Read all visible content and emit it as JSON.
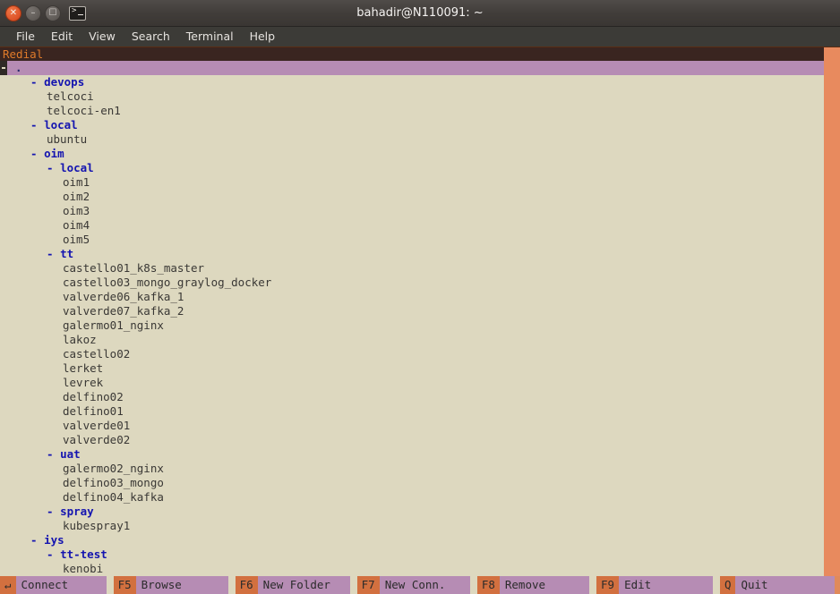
{
  "window": {
    "title": "bahadir@N110091: ~",
    "buttons": [
      {
        "name": "close",
        "glyph": "✕"
      },
      {
        "name": "minimize",
        "glyph": "–"
      },
      {
        "name": "maximize",
        "glyph": "☐"
      }
    ],
    "terminal_icon": "terminal-icon"
  },
  "menubar": {
    "items": [
      "File",
      "Edit",
      "View",
      "Search",
      "Terminal",
      "Help"
    ]
  },
  "app": {
    "header_title": "Redial",
    "selected_entry": {
      "marker": "-",
      "label": "."
    }
  },
  "colors": {
    "terminal_background": "#ddd8bf",
    "header_background": "#3a2520",
    "header_text": "#e07b2a",
    "selection_background": "#b68cb4",
    "folder_text": "#1414b0",
    "leaf_text": "#3a3835",
    "fnkey_background": "#d2703f",
    "fnlabel_background": "#b68cb4",
    "scrollbar": "#e08a5a"
  },
  "tree": [
    {
      "indent": 1,
      "type": "folder",
      "marker": "-",
      "name": "devops"
    },
    {
      "indent": 2,
      "type": "leaf",
      "marker": "",
      "name": "telcoci"
    },
    {
      "indent": 2,
      "type": "leaf",
      "marker": "",
      "name": "telcoci-en1"
    },
    {
      "indent": 1,
      "type": "folder",
      "marker": "-",
      "name": "local"
    },
    {
      "indent": 2,
      "type": "leaf",
      "marker": "",
      "name": "ubuntu"
    },
    {
      "indent": 1,
      "type": "folder",
      "marker": "-",
      "name": "oim"
    },
    {
      "indent": 2,
      "type": "folder",
      "marker": "-",
      "name": "local"
    },
    {
      "indent": 3,
      "type": "leaf",
      "marker": "",
      "name": "oim1"
    },
    {
      "indent": 3,
      "type": "leaf",
      "marker": "",
      "name": "oim2"
    },
    {
      "indent": 3,
      "type": "leaf",
      "marker": "",
      "name": "oim3"
    },
    {
      "indent": 3,
      "type": "leaf",
      "marker": "",
      "name": "oim4"
    },
    {
      "indent": 3,
      "type": "leaf",
      "marker": "",
      "name": "oim5"
    },
    {
      "indent": 2,
      "type": "folder",
      "marker": "-",
      "name": "tt"
    },
    {
      "indent": 3,
      "type": "leaf",
      "marker": "",
      "name": "castello01_k8s_master"
    },
    {
      "indent": 3,
      "type": "leaf",
      "marker": "",
      "name": "castello03_mongo_graylog_docker"
    },
    {
      "indent": 3,
      "type": "leaf",
      "marker": "",
      "name": "valverde06_kafka_1"
    },
    {
      "indent": 3,
      "type": "leaf",
      "marker": "",
      "name": "valverde07_kafka_2"
    },
    {
      "indent": 3,
      "type": "leaf",
      "marker": "",
      "name": "galermo01_nginx"
    },
    {
      "indent": 3,
      "type": "leaf",
      "marker": "",
      "name": "lakoz"
    },
    {
      "indent": 3,
      "type": "leaf",
      "marker": "",
      "name": "castello02"
    },
    {
      "indent": 3,
      "type": "leaf",
      "marker": "",
      "name": "lerket"
    },
    {
      "indent": 3,
      "type": "leaf",
      "marker": "",
      "name": "levrek"
    },
    {
      "indent": 3,
      "type": "leaf",
      "marker": "",
      "name": "delfino02"
    },
    {
      "indent": 3,
      "type": "leaf",
      "marker": "",
      "name": "delfino01"
    },
    {
      "indent": 3,
      "type": "leaf",
      "marker": "",
      "name": "valverde01"
    },
    {
      "indent": 3,
      "type": "leaf",
      "marker": "",
      "name": "valverde02"
    },
    {
      "indent": 2,
      "type": "folder",
      "marker": "-",
      "name": "uat"
    },
    {
      "indent": 3,
      "type": "leaf",
      "marker": "",
      "name": "galermo02_nginx"
    },
    {
      "indent": 3,
      "type": "leaf",
      "marker": "",
      "name": "delfino03_mongo"
    },
    {
      "indent": 3,
      "type": "leaf",
      "marker": "",
      "name": "delfino04_kafka"
    },
    {
      "indent": 2,
      "type": "folder",
      "marker": "-",
      "name": "spray"
    },
    {
      "indent": 3,
      "type": "leaf",
      "marker": "",
      "name": "kubespray1"
    },
    {
      "indent": 1,
      "type": "folder",
      "marker": "-",
      "name": "iys"
    },
    {
      "indent": 2,
      "type": "folder",
      "marker": "-",
      "name": "tt-test"
    },
    {
      "indent": 3,
      "type": "leaf",
      "marker": "",
      "name": "kenobi"
    }
  ],
  "function_bar": [
    {
      "key": "↵",
      "label": "Connect",
      "name": "connect"
    },
    {
      "key": "F5",
      "label": "Browse",
      "name": "browse"
    },
    {
      "key": "F6",
      "label": "New Folder",
      "name": "new-folder"
    },
    {
      "key": "F7",
      "label": "New Conn.",
      "name": "new-conn"
    },
    {
      "key": "F8",
      "label": "Remove",
      "name": "remove"
    },
    {
      "key": "F9",
      "label": "Edit",
      "name": "edit"
    },
    {
      "key": "Q",
      "label": "Quit",
      "name": "quit"
    }
  ]
}
